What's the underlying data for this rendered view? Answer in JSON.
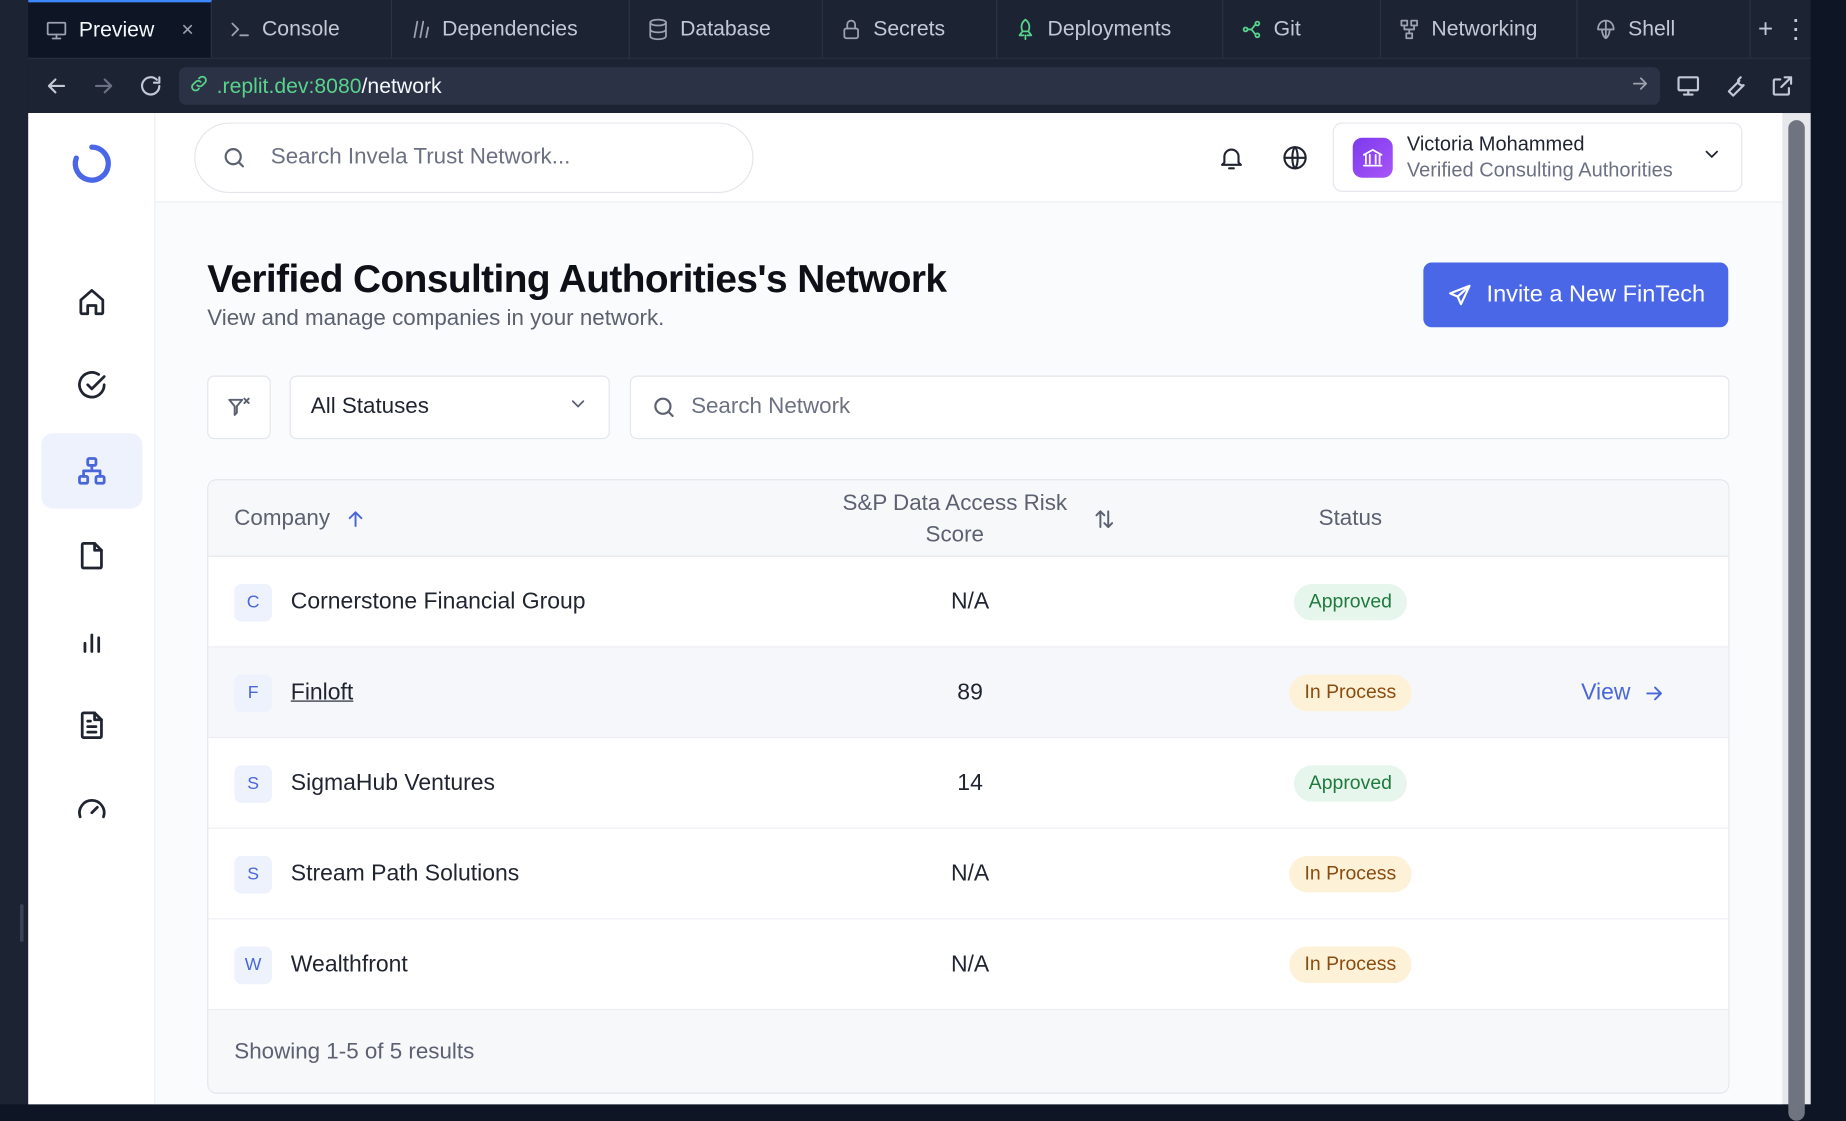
{
  "ide": {
    "tabs": [
      {
        "label": "Preview",
        "icon": "monitor-icon",
        "active": true
      },
      {
        "label": "Console",
        "icon": "terminal-icon"
      },
      {
        "label": "Dependencies",
        "icon": "dependencies-icon"
      },
      {
        "label": "Database",
        "icon": "database-icon"
      },
      {
        "label": "Secrets",
        "icon": "lock-icon"
      },
      {
        "label": "Deployments",
        "icon": "deployments-icon"
      },
      {
        "label": "Git",
        "icon": "git-icon"
      },
      {
        "label": "Networking",
        "icon": "networking-icon"
      },
      {
        "label": "Shell",
        "icon": "shell-icon"
      }
    ],
    "add_tab": "+",
    "more": "⋮",
    "close": "×",
    "url": {
      "host": ".replit.dev:8080",
      "path": "/network"
    }
  },
  "app": {
    "search_placeholder": "Search Invela Trust Network...",
    "user": {
      "name": "Victoria Mohammed",
      "org": "Verified Consulting Authorities"
    },
    "page": {
      "title": "Verified Consulting Authorities's Network",
      "subtitle": "View and manage companies in your network.",
      "invite_label": "Invite a New FinTech"
    },
    "filters": {
      "status_value": "All Statuses",
      "search_placeholder": "Search Network"
    },
    "table": {
      "columns": {
        "company": "Company",
        "risk": "S&P Data Access Risk Score",
        "status": "Status"
      },
      "rows": [
        {
          "initial": "C",
          "name": "Cornerstone Financial Group",
          "score": "N/A",
          "status": "Approved"
        },
        {
          "initial": "F",
          "name": "Finloft",
          "score": "89",
          "status": "In Process",
          "action": "View"
        },
        {
          "initial": "S",
          "name": "SigmaHub Ventures",
          "score": "14",
          "status": "Approved"
        },
        {
          "initial": "S",
          "name": "Stream Path Solutions",
          "score": "N/A",
          "status": "In Process"
        },
        {
          "initial": "W",
          "name": "Wealthfront",
          "score": "N/A",
          "status": "In Process"
        }
      ],
      "footer": "Showing 1-5 of 5 results"
    },
    "colors": {
      "accent": "#4a67e8",
      "approved_bg": "#e7f6ec",
      "in_process_bg": "#fdf2d8"
    }
  }
}
